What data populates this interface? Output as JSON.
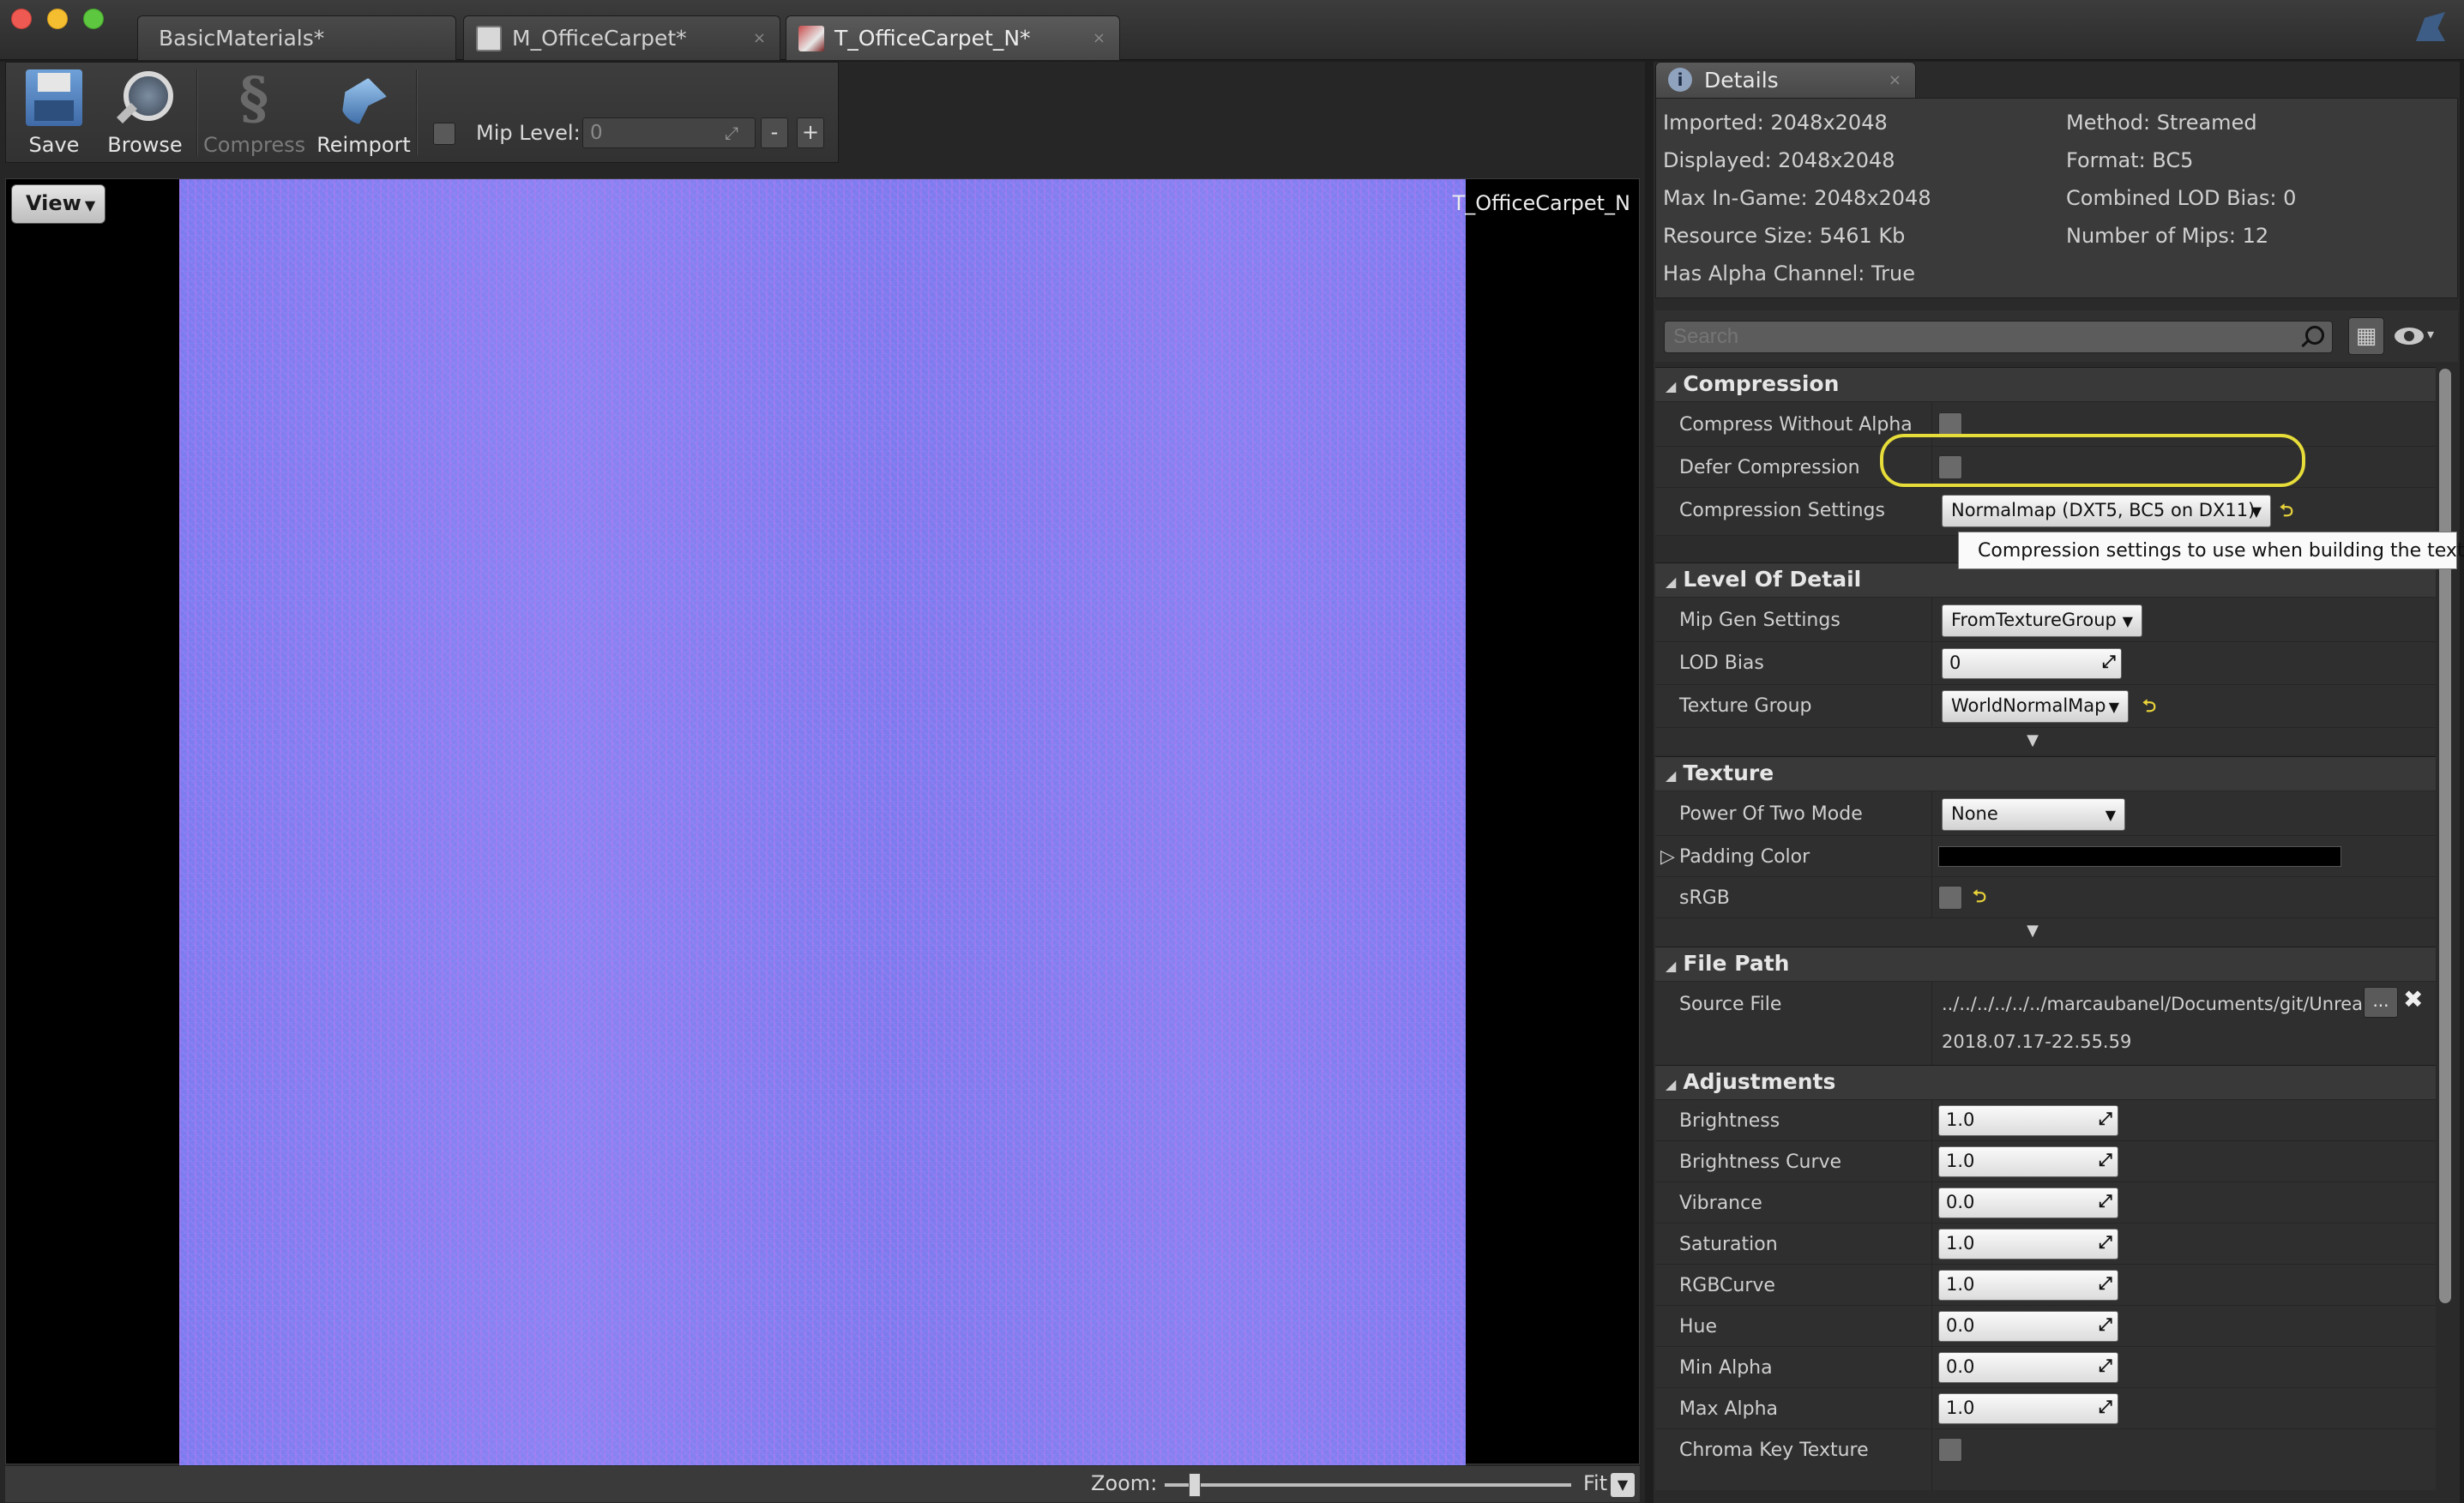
{
  "window": {
    "tabs": [
      {
        "label": "BasicMaterials*"
      },
      {
        "label": "M_OfficeCarpet*"
      },
      {
        "label": "T_OfficeCarpet_N*"
      }
    ],
    "close_glyph": "×"
  },
  "toolbar": {
    "save_label": "Save",
    "browse_label": "Browse",
    "compress_label": "Compress",
    "reimport_label": "Reimport",
    "mip_label": "Mip Level:",
    "mip_value": "0",
    "mip_minus": "-",
    "mip_plus": "+"
  },
  "viewport": {
    "view_label": "View",
    "texture_name": "T_OfficeCarpet_N",
    "zoom_label": "Zoom:",
    "zoom_value": "Fit"
  },
  "details": {
    "tab_label": "Details",
    "info": {
      "imported": "Imported: 2048x2048",
      "displayed": "Displayed: 2048x2048",
      "max_in_game": "Max In-Game: 2048x2048",
      "resource_size": "Resource Size: 5461 Kb",
      "has_alpha": "Has Alpha Channel: True",
      "method": "Method: Streamed",
      "format": "Format: BC5",
      "lod_bias": "Combined LOD Bias: 0",
      "num_mips": "Number of Mips: 12"
    },
    "search_placeholder": "Search",
    "tooltip": "Compression settings to use when building the texture.",
    "compression": {
      "title": "Compression",
      "compress_without_alpha": "Compress Without Alpha",
      "defer_compression": "Defer Compression",
      "compression_settings": "Compression Settings",
      "compression_settings_value": "Normalmap (DXT5, BC5 on DX11)"
    },
    "lod": {
      "title": "Level Of Detail",
      "mip_gen_settings": "Mip Gen Settings",
      "mip_gen_value": "FromTextureGroup",
      "lod_bias": "LOD Bias",
      "lod_bias_value": "0",
      "texture_group": "Texture Group",
      "texture_group_value": "WorldNormalMap"
    },
    "texture": {
      "title": "Texture",
      "power_of_two": "Power Of Two Mode",
      "power_of_two_value": "None",
      "padding_color": "Padding Color",
      "srgb": "sRGB"
    },
    "file_path": {
      "title": "File Path",
      "source_file": "Source File",
      "source_value": "../../../../../../marcaubanel/Documents/git/Unrea",
      "timestamp": "2018.07.17-22.55.59",
      "browse_glyph": "...",
      "clear_glyph": "✖"
    },
    "adjustments": {
      "title": "Adjustments",
      "brightness": "Brightness",
      "brightness_value": "1.0",
      "brightness_curve": "Brightness Curve",
      "brightness_curve_value": "1.0",
      "vibrance": "Vibrance",
      "vibrance_value": "0.0",
      "saturation": "Saturation",
      "saturation_value": "1.0",
      "rgbcurve": "RGBCurve",
      "rgbcurve_value": "1.0",
      "hue": "Hue",
      "hue_value": "0.0",
      "min_alpha": "Min Alpha",
      "min_alpha_value": "0.0",
      "max_alpha": "Max Alpha",
      "max_alpha_value": "1.0",
      "chroma_key": "Chroma Key Texture"
    }
  },
  "colors": {
    "highlight": "#e6dc3a",
    "panel_bg": "#2c2c2c",
    "texture_tint": "#8580f0"
  }
}
